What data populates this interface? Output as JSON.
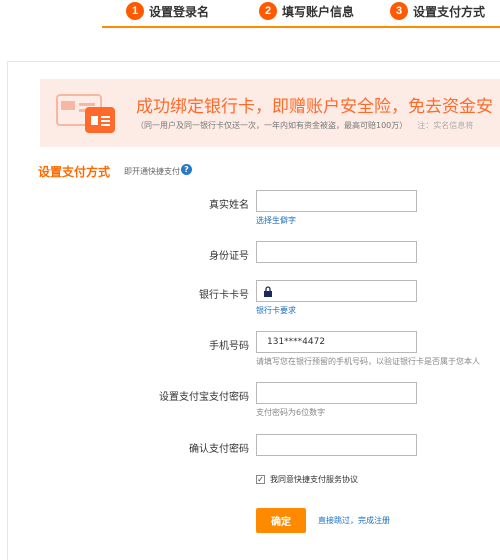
{
  "steps": [
    {
      "num": "1",
      "label": "设置登录名"
    },
    {
      "num": "2",
      "label": "填写账户信息"
    },
    {
      "num": "3",
      "label": "设置支付方式"
    }
  ],
  "banner": {
    "title": "成功绑定银行卡，即赠账户安全险，免去资金安",
    "sub": "（同一用户及同一银行卡仅送一次，一年内如有资金被盗，最高可赔100万）",
    "note": "注：实名信息将"
  },
  "section": {
    "title": "设置支付方式",
    "sub": "即开通快捷支付",
    "help": "?"
  },
  "form": {
    "name_label": "真实姓名",
    "name_hint": "选择生僻字",
    "id_label": "身份证号",
    "card_label": "银行卡卡号",
    "card_hint": "银行卡要求",
    "phone_label": "手机号码",
    "phone_value": "131****4472",
    "phone_hint": "请填写您在银行预留的手机号码，以验证银行卡是否属于您本人",
    "pay_pwd_label": "设置支付宝支付密码",
    "pay_pwd_hint": "支付密码为6位数字",
    "confirm_pwd_label": "确认支付密码",
    "agree_label": "我同意快捷支付服务协议",
    "agree_mark": "✓",
    "submit_label": "确定",
    "skip_label": "直接跳过，完成注册"
  },
  "colors": {
    "accent": "#ff6a00",
    "link": "#1c6fc2",
    "banner_bg": "#fdece6",
    "button": "#ff8a00"
  }
}
